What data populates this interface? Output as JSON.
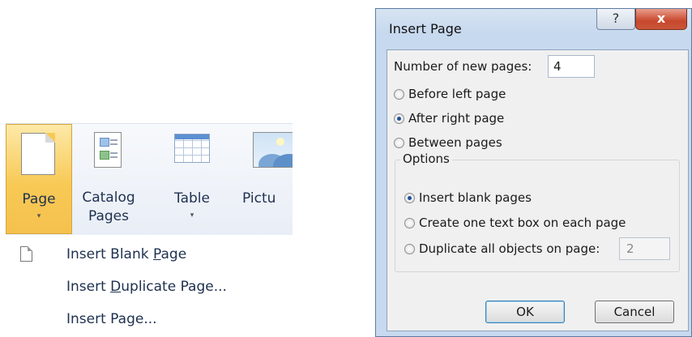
{
  "ribbon": {
    "buttons": [
      {
        "label": "Page",
        "icon": "blank-page-icon",
        "has_dropdown": true,
        "active": true
      },
      {
        "label_line1": "Catalog",
        "label_line2": "Pages",
        "icon": "catalog-pages-icon"
      },
      {
        "label": "Table",
        "icon": "table-icon",
        "has_dropdown": true
      },
      {
        "label": "Pictu",
        "icon": "picture-icon"
      }
    ],
    "dropdown_arrow": "▾"
  },
  "menu": {
    "items": [
      {
        "pre": "Insert Blank ",
        "key": "P",
        "post": "age",
        "icon": "blank-page-icon"
      },
      {
        "pre": "Insert ",
        "key": "D",
        "post": "uplicate Page..."
      },
      {
        "pre": "Insert Page...",
        "key": "",
        "post": ""
      }
    ]
  },
  "dialog": {
    "title": "Insert Page",
    "help_label": "?",
    "close_label": "x",
    "number_label": "Number of new pages:",
    "number_value": "4",
    "placement_options": [
      {
        "label": "Before left page",
        "selected": false
      },
      {
        "label": "After right page",
        "selected": true
      },
      {
        "label": "Between pages",
        "selected": false
      }
    ],
    "options_group": {
      "title": "Options",
      "items": [
        {
          "label": "Insert blank pages",
          "selected": true
        },
        {
          "label": "Create one text box on each page",
          "selected": false
        },
        {
          "label": "Duplicate all objects on page:",
          "selected": false
        }
      ],
      "duplicate_page_value": "2"
    },
    "ok_label": "OK",
    "cancel_label": "Cancel"
  },
  "colors": {
    "page_button_highlight": "#f8c955",
    "dialog_frame": "#c7d9ee",
    "close_button": "#c8472c"
  }
}
